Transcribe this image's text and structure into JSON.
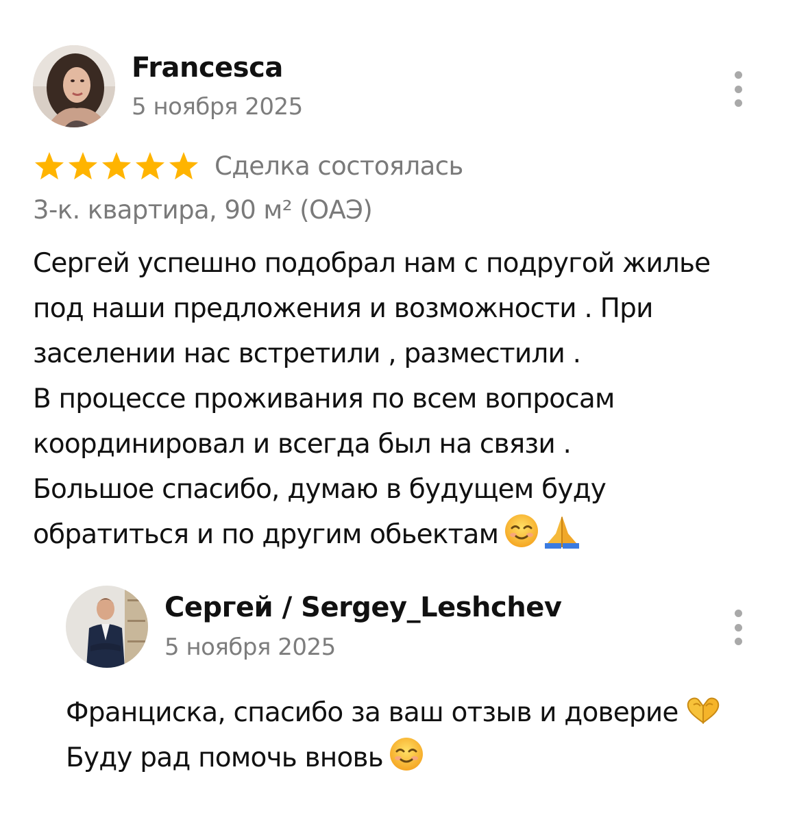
{
  "review": {
    "author": "Francesca",
    "date": "5 ноября 2025",
    "rating": 5,
    "rating_max": 5,
    "status": "Сделка состоялась",
    "listing": "3-к. квартира, 90 м² (ОАЭ)",
    "text_lines": [
      "Сергей успешно подобрал нам с подругой жилье",
      "под наши предложения и возможности . При",
      "заселении нас встретили , разместили .",
      "В процессе проживания по всем вопросам",
      "координировал и всегда был на связи .",
      "Большое спасибо, думаю в будущем буду",
      "обратиться и по другим обьектам"
    ],
    "text_trailing_emojis": [
      "smiling-face-emoji",
      "folded-hands-emoji"
    ],
    "menu_icon": "more-vertical-icon"
  },
  "reply": {
    "author": "Сергей / Sergey_Leshchev",
    "date": "5 ноября 2025",
    "text_lines": [
      "Франциска, спасибо за ваш отзыв и доверие",
      "Буду рад помочь вновь"
    ],
    "line_emojis": [
      "heart-hands-emoji",
      "smiling-face-emoji"
    ],
    "menu_icon": "more-vertical-icon"
  },
  "colors": {
    "star": "#FFB400",
    "secondary_text": "#7a7a7a",
    "primary_text": "#111111",
    "menu_dots": "#a9a9a9"
  }
}
